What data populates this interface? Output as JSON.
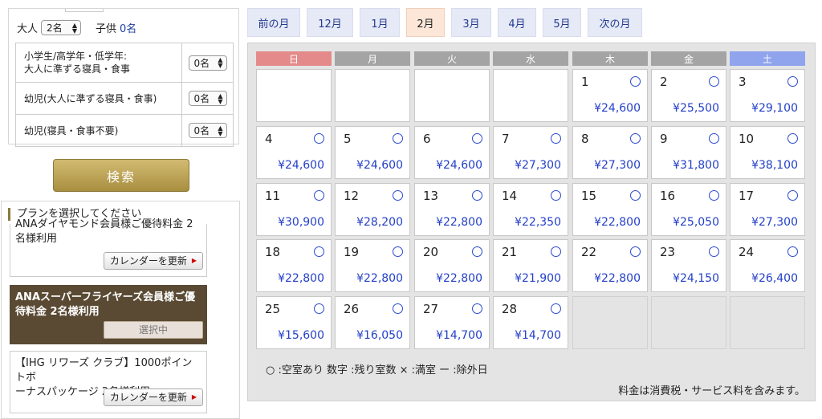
{
  "search_panel": {
    "adult_label": "大人",
    "adult_value": "2名",
    "child_label": "子供",
    "child_count": "0名",
    "kid_rows": [
      {
        "label_line1": "小学生/高学年・低学年:",
        "label_line2": "大人に準ずる寝具・食事",
        "value": "0名"
      },
      {
        "label_line1": "幼児(大人に準ずる寝具・食事)",
        "label_line2": "",
        "value": "0名"
      },
      {
        "label_line1": "幼児(寝具・食事不要)",
        "label_line2": "",
        "value": "0名"
      }
    ],
    "search_button": "検索"
  },
  "plans": {
    "heading": "プランを選択してください",
    "items": [
      {
        "line1": "ANAダイヤモンド会員様ご優待料金 2",
        "line2": "名様利用",
        "button": "カレンダーを更新"
      },
      {
        "line1": "ANAスーパーフライヤーズ会員様ご優",
        "line2": "待料金 2名様利用",
        "button": "選択中"
      },
      {
        "line1": "【IHG リワーズ クラブ】1000ポイントボ",
        "line2": "ーナスパッケージ 2名様利用",
        "button": "カレンダーを更新"
      }
    ]
  },
  "month_nav": [
    {
      "label": "前の月",
      "active": false
    },
    {
      "label": "12月",
      "active": false
    },
    {
      "label": "1月",
      "active": false
    },
    {
      "label": "2月",
      "active": true
    },
    {
      "label": "3月",
      "active": false
    },
    {
      "label": "4月",
      "active": false
    },
    {
      "label": "5月",
      "active": false
    },
    {
      "label": "次の月",
      "active": false
    }
  ],
  "calendar": {
    "weekdays": [
      "日",
      "月",
      "火",
      "水",
      "木",
      "金",
      "土"
    ],
    "leading_blank": 4,
    "days": [
      {
        "day": "1",
        "price": "¥24,600"
      },
      {
        "day": "2",
        "price": "¥25,500"
      },
      {
        "day": "3",
        "price": "¥29,100"
      },
      {
        "day": "4",
        "price": "¥24,600"
      },
      {
        "day": "5",
        "price": "¥24,600"
      },
      {
        "day": "6",
        "price": "¥24,600"
      },
      {
        "day": "7",
        "price": "¥27,300"
      },
      {
        "day": "8",
        "price": "¥27,300"
      },
      {
        "day": "9",
        "price": "¥31,800"
      },
      {
        "day": "10",
        "price": "¥38,100"
      },
      {
        "day": "11",
        "price": "¥30,900"
      },
      {
        "day": "12",
        "price": "¥28,200"
      },
      {
        "day": "13",
        "price": "¥22,800"
      },
      {
        "day": "14",
        "price": "¥22,350"
      },
      {
        "day": "15",
        "price": "¥22,800"
      },
      {
        "day": "16",
        "price": "¥25,050"
      },
      {
        "day": "17",
        "price": "¥27,300"
      },
      {
        "day": "18",
        "price": "¥22,800"
      },
      {
        "day": "19",
        "price": "¥22,800"
      },
      {
        "day": "20",
        "price": "¥22,800"
      },
      {
        "day": "21",
        "price": "¥21,900"
      },
      {
        "day": "22",
        "price": "¥22,800"
      },
      {
        "day": "23",
        "price": "¥24,150"
      },
      {
        "day": "24",
        "price": "¥26,400"
      },
      {
        "day": "25",
        "price": "¥15,600"
      },
      {
        "day": "26",
        "price": "¥16,050"
      },
      {
        "day": "27",
        "price": "¥14,700"
      },
      {
        "day": "28",
        "price": "¥14,700"
      }
    ],
    "legend": "○ :空室あり 数字 :残り室数 × :満室 ー :除外日",
    "tax_note": "料金は消費税・サービス料を含みます。"
  }
}
